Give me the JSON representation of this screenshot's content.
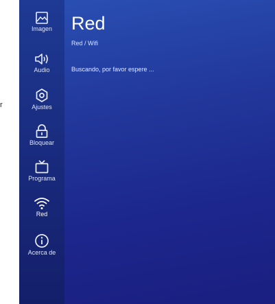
{
  "stray_text": "r",
  "sidebar": {
    "items": [
      {
        "label": "Imagen",
        "icon": "image-icon"
      },
      {
        "label": "Audio",
        "icon": "speaker-icon"
      },
      {
        "label": "Ajustes",
        "icon": "gear-icon"
      },
      {
        "label": "Bloquear",
        "icon": "lock-icon"
      },
      {
        "label": "Programa",
        "icon": "tv-icon"
      },
      {
        "label": "Red",
        "icon": "wifi-icon"
      },
      {
        "label": "Acerca de",
        "icon": "info-icon"
      }
    ],
    "active_index": 5
  },
  "main": {
    "title": "Red",
    "breadcrumb": "Red  /  Wifi",
    "status": "Buscando, por favor espere ..."
  },
  "colors": {
    "background_top": "#2a50b4",
    "background_bottom": "#1a1f80",
    "sidebar": "#18287a",
    "text": "#ffffff"
  }
}
